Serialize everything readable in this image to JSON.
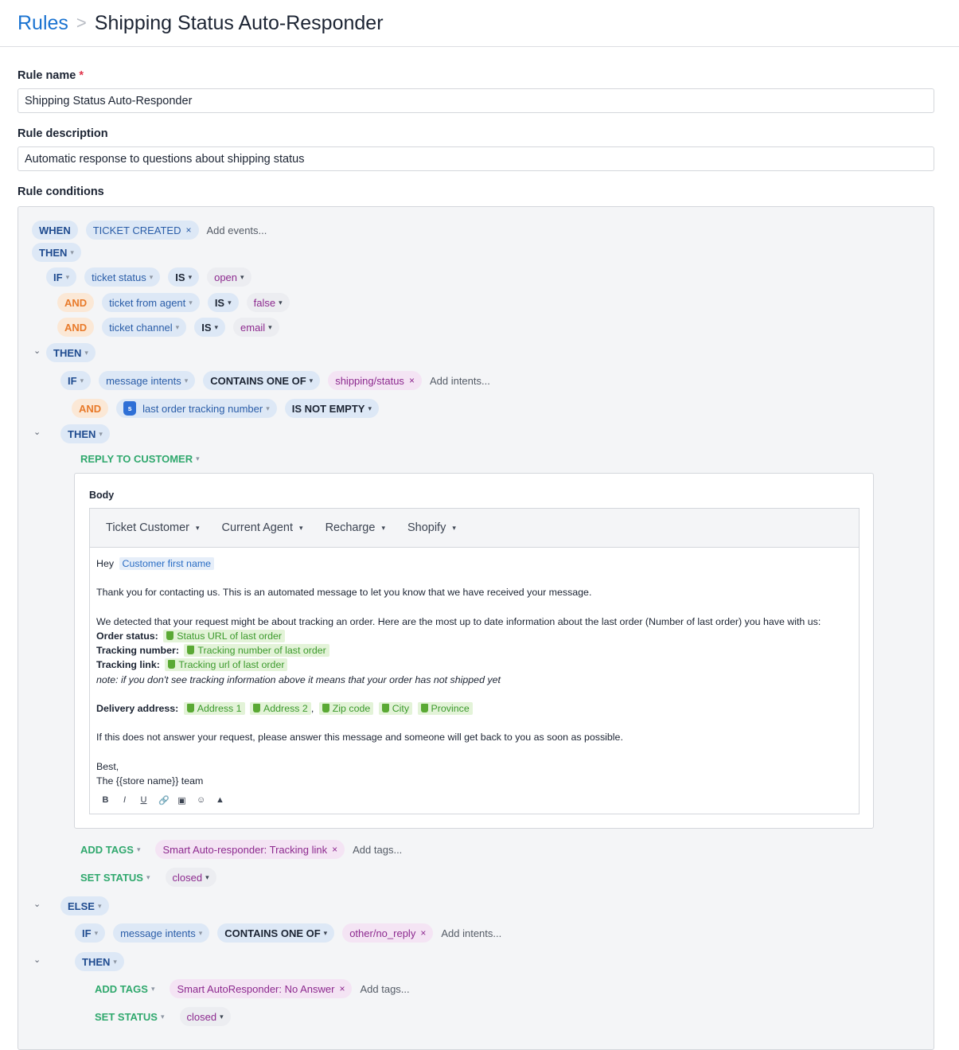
{
  "breadcrumb": {
    "root": "Rules",
    "separator": ">",
    "current": "Shipping Status Auto-Responder"
  },
  "form": {
    "rule_name_label": "Rule name",
    "required_marker": "*",
    "rule_name_value": "Shipping Status Auto-Responder",
    "rule_description_label": "Rule description",
    "rule_description_value": "Automatic response to questions about shipping status",
    "rule_conditions_label": "Rule conditions"
  },
  "rule": {
    "when": "WHEN",
    "event": "TICKET CREATED",
    "add_events": "Add events...",
    "then": "THEN",
    "if": "IF",
    "and": "AND",
    "is": "IS",
    "else": "ELSE",
    "contains_one_of": "CONTAINS ONE OF",
    "is_not_empty": "IS NOT EMPTY",
    "remove_glyph": "×",
    "caret_glyph": "▾",
    "chevron_glyph": "⌄",
    "cond1": {
      "field": "ticket status",
      "value": "open"
    },
    "cond2": {
      "field": "ticket from agent",
      "value": "false"
    },
    "cond3": {
      "field": "ticket channel",
      "value": "email"
    },
    "intent_cond": {
      "field": "message intents",
      "value": "shipping/status",
      "add": "Add intents..."
    },
    "tracking_cond": {
      "field": "last order tracking number"
    },
    "reply_action": "REPLY TO CUSTOMER",
    "add_tags_action": "ADD TAGS",
    "set_status_action": "SET STATUS",
    "tag1": "Smart Auto-responder: Tracking link",
    "add_tags": "Add tags...",
    "status1": "closed",
    "else_cond": {
      "field": "message intents",
      "value": "other/no_reply",
      "add": "Add intents..."
    },
    "tag2": "Smart AutoResponder: No Answer",
    "status2": "closed"
  },
  "reply": {
    "body_label": "Body",
    "variable_menus": [
      "Ticket Customer",
      "Current Agent",
      "Recharge",
      "Shopify"
    ],
    "greeting": "Hey",
    "var_customer_first_name": "Customer first name",
    "line_thanks": "Thank you for contacting us. This is an automated message to let you know that we have received your message.",
    "line_detected": "We detected that your request might be about tracking an order. Here are the most up to date information about the last order (Number of last order) you have with us:",
    "order_status_label": "Order status:",
    "var_status_url": "Status URL of last order",
    "tracking_number_label": "Tracking number:",
    "var_tracking_number": "Tracking number of last order",
    "tracking_link_label": "Tracking link:",
    "var_tracking_url": "Tracking url of last order",
    "note": "note: if you don't see tracking information above it means that your order has not shipped yet",
    "delivery_label": "Delivery address:",
    "var_address1": "Address 1",
    "var_address2": "Address 2",
    "comma": ",",
    "var_zip": "Zip code",
    "var_city": "City",
    "var_province": "Province",
    "line_fallback": "If this does not answer your request, please answer this message and someone will get back to you as soon as possible.",
    "sign_best": "Best,",
    "sign_team": "The {{store name}} team",
    "toolbar": {
      "bold": "B",
      "italic": "I",
      "underline": "U",
      "link": "🔗",
      "image": "▣",
      "emoji": "☺",
      "shopify": "▲"
    }
  },
  "colors": {
    "accent": "#1a73d1",
    "action_green": "#2fa86d",
    "and_orange": "#e87a2a",
    "value_purple": "#8d2a8f"
  }
}
